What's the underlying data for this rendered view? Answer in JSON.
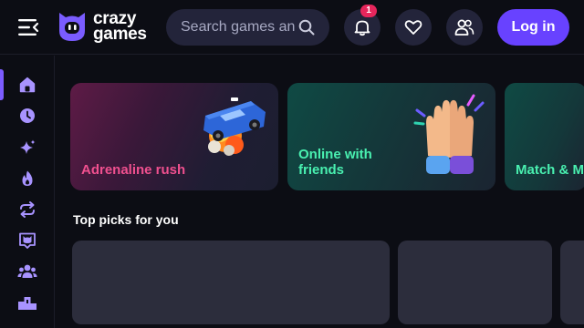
{
  "header": {
    "logo_line1": "crazy",
    "logo_line2": "games",
    "search_placeholder": "Search games and categories",
    "notification_count": "1",
    "login_label": "Log in"
  },
  "sidebar": {
    "items": [
      {
        "name": "home",
        "icon": "home-icon"
      },
      {
        "name": "recent",
        "icon": "clock-icon"
      },
      {
        "name": "new",
        "icon": "sparkle-icon"
      },
      {
        "name": "trending",
        "icon": "flame-icon"
      },
      {
        "name": "updated",
        "icon": "refresh-icon"
      },
      {
        "name": "originals",
        "icon": "logo-icon"
      },
      {
        "name": "multiplayer",
        "icon": "users-icon"
      },
      {
        "name": "leaderboard",
        "icon": "podium-icon"
      }
    ]
  },
  "categories": [
    {
      "label": "Adrenaline rush",
      "color": "#f0508f"
    },
    {
      "label": "Online with friends",
      "color": "#49f0b0"
    },
    {
      "label": "Match & Merge",
      "color": "#49f0b0"
    }
  ],
  "sections": {
    "top_picks_title": "Top picks for you"
  },
  "colors": {
    "accent": "#6842ff",
    "background": "#0c0d14",
    "surface": "#23243a",
    "badge": "#e6265c"
  }
}
